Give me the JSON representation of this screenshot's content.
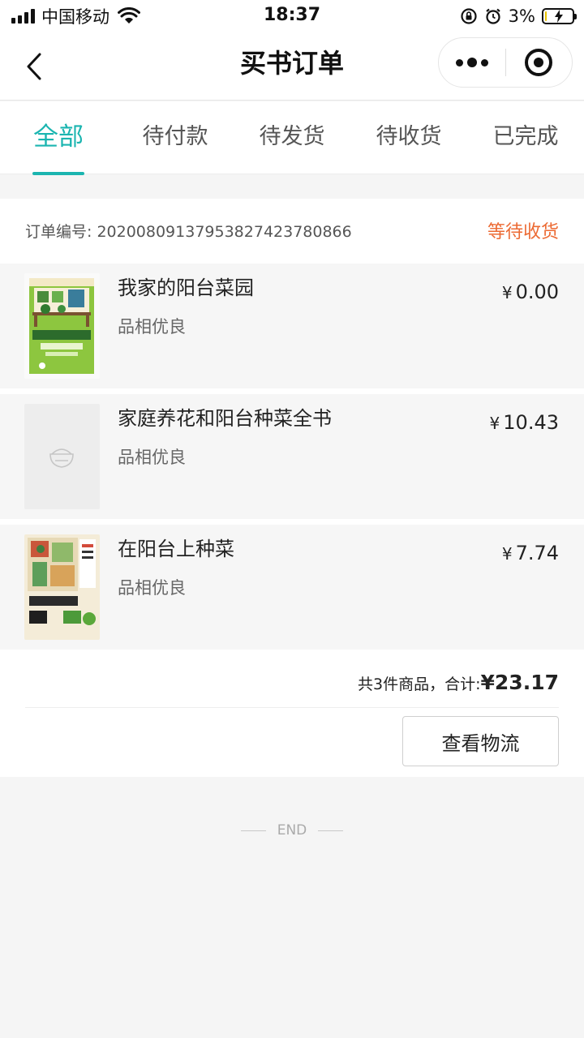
{
  "status_bar": {
    "carrier": "中国移动",
    "time": "18:37",
    "battery_percent": "3%",
    "battery_level": 0.03,
    "icons": [
      "signal-icon",
      "wifi-icon",
      "rotation-lock-icon",
      "alarm-icon",
      "battery-charging-icon"
    ]
  },
  "nav": {
    "title": "买书订单",
    "icons": [
      "back-chevron-icon",
      "more-dots-icon",
      "close-target-icon"
    ]
  },
  "tabs": [
    {
      "label": "全部",
      "active": true
    },
    {
      "label": "待付款",
      "active": false
    },
    {
      "label": "待发货",
      "active": false
    },
    {
      "label": "待收货",
      "active": false
    },
    {
      "label": "已完成",
      "active": false
    }
  ],
  "order": {
    "number_label": "订单编号: 2020080913795382742378086​6",
    "status": "等待收货",
    "items": [
      {
        "title": "我家的阳台菜园",
        "condition": "品相优良",
        "price": "0.00",
        "currency": "¥",
        "cover": "book-cover-1"
      },
      {
        "title": "家庭养花和阳台种菜全书",
        "condition": "品相优良",
        "price": "10.43",
        "currency": "¥",
        "cover": "placeholder-cover"
      },
      {
        "title": "在阳台上种菜",
        "condition": "品相优良",
        "price": "7.74",
        "currency": "¥",
        "cover": "book-cover-3"
      }
    ],
    "summary_prefix": "共3件商品，合计:",
    "total": "¥23.17",
    "logistics_button": "查看物流"
  },
  "end_text": "END",
  "colors": {
    "accent": "#1bb5b0",
    "status_orange": "#ec6a33",
    "page_bg": "#f5f5f5"
  }
}
